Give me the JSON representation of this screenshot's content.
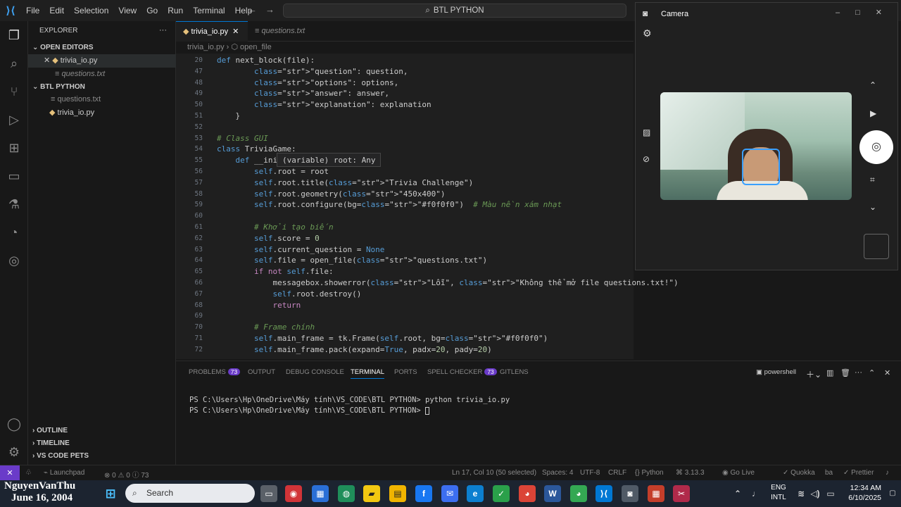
{
  "menu": [
    "File",
    "Edit",
    "Selection",
    "View",
    "Go",
    "Run",
    "Terminal",
    "Help"
  ],
  "command_center": "BTL PYTHON",
  "explorer": {
    "title": "EXPLORER",
    "open_editors_label": "OPEN EDITORS",
    "open_files": [
      "trivia_io.py",
      "questions.txt"
    ],
    "project_label": "BTL PYTHON",
    "project_files": [
      "questions.txt",
      "trivia_io.py"
    ]
  },
  "tabs": [
    {
      "label": "trivia_io.py",
      "active": true
    },
    {
      "label": "questions.txt",
      "active": false
    }
  ],
  "breadcrumb": {
    "file": "trivia_io.py",
    "symbol": "open_file"
  },
  "editor": {
    "lines": [
      {
        "n": "20",
        "text": "def next_block(file):"
      },
      {
        "n": "47",
        "text": "        \"question\": question,"
      },
      {
        "n": "48",
        "text": "        \"options\": options,"
      },
      {
        "n": "49",
        "text": "        \"answer\": answer,"
      },
      {
        "n": "50",
        "text": "        \"explanation\": explanation"
      },
      {
        "n": "51",
        "text": "    }"
      },
      {
        "n": "52",
        "text": ""
      },
      {
        "n": "53",
        "text": "# Class GUI"
      },
      {
        "n": "54",
        "text": "class TriviaGame:"
      },
      {
        "n": "55",
        "text": "    def __init__(self, root):"
      },
      {
        "n": "56",
        "text": "        self.root = root"
      },
      {
        "n": "57",
        "text": "        self.root.title(\"Trivia Challenge\")"
      },
      {
        "n": "58",
        "text": "        self.root.geometry(\"450x400\")"
      },
      {
        "n": "59",
        "text": "        self.root.configure(bg=\"#f0f0f0\")  # Màu nền xám nhạt"
      },
      {
        "n": "60",
        "text": ""
      },
      {
        "n": "61",
        "text": "        # Khởi tạo biến"
      },
      {
        "n": "62",
        "text": "        self.score = 0"
      },
      {
        "n": "63",
        "text": "        self.current_question = None"
      },
      {
        "n": "64",
        "text": "        self.file = open_file(\"questions.txt\")"
      },
      {
        "n": "65",
        "text": "        if not self.file:"
      },
      {
        "n": "66",
        "text": "            messagebox.showerror(\"Lỗi\", \"Không thể mở file questions.txt!\")"
      },
      {
        "n": "67",
        "text": "            self.root.destroy()"
      },
      {
        "n": "68",
        "text": "            return"
      },
      {
        "n": "69",
        "text": ""
      },
      {
        "n": "70",
        "text": "        # Frame chính"
      },
      {
        "n": "71",
        "text": "        self.main_frame = tk.Frame(self.root, bg=\"#f0f0f0\")"
      },
      {
        "n": "72",
        "text": "        self.main_frame.pack(expand=True, padx=20, pady=20)"
      }
    ],
    "hover_tooltip": "(variable) root: Any"
  },
  "panel": {
    "tabs": [
      {
        "label": "PROBLEMS",
        "badge": "73"
      },
      {
        "label": "OUTPUT"
      },
      {
        "label": "DEBUG CONSOLE"
      },
      {
        "label": "TERMINAL",
        "active": true
      },
      {
        "label": "PORTS"
      },
      {
        "label": "SPELL CHECKER",
        "badge": "73"
      },
      {
        "label": "GITLENS"
      }
    ],
    "shell": "powershell",
    "terminal_lines": [
      "PS C:\\Users\\Hp\\OneDrive\\Máy tính\\VS_CODE\\BTL PYTHON> python trivia_io.py",
      "PS C:\\Users\\Hp\\OneDrive\\Máy tính\\VS_CODE\\BTL PYTHON> "
    ]
  },
  "side_sections": [
    "OUTLINE",
    "TIMELINE",
    "VS CODE PETS"
  ],
  "status": {
    "launchpad": "Launchpad",
    "problems": "⊗ 0 ⚠ 0 ⓘ 73",
    "position": "Ln 17, Col 10 (50 selected)",
    "spaces": "Spaces: 4",
    "encoding": "UTF-8",
    "eol": "CRLF",
    "language": "Python",
    "version": "3.13.3",
    "golive": "Go Live",
    "quokka": "Quokka",
    "prettier": "Prettier"
  },
  "camera": {
    "title": "Camera"
  },
  "taskbar": {
    "watermark_name": "NguyenVanThu",
    "watermark_date": "June 16, 2004",
    "search_placeholder": "Search",
    "lang_line1": "ENG",
    "lang_line2": "INTL",
    "time": "12:34 AM",
    "date": "6/10/2025"
  }
}
